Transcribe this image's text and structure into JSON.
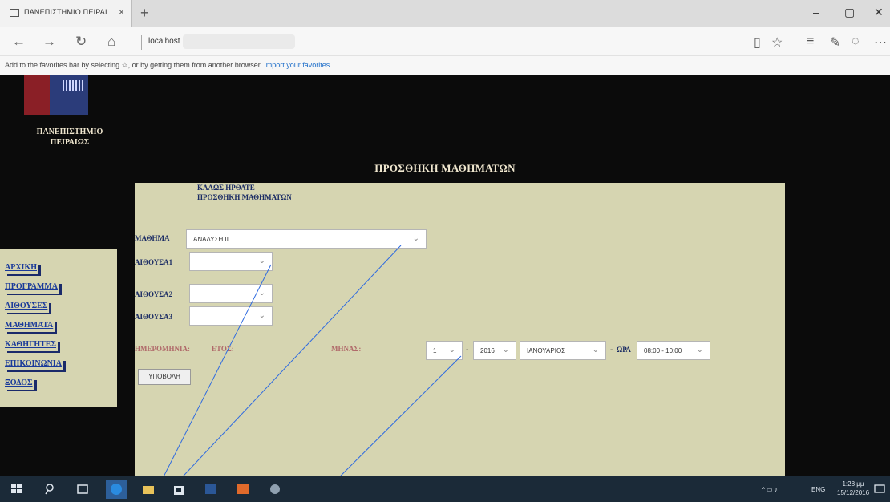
{
  "browser": {
    "tab_title": "ΠΑΝΕΠΙΣΤΗΜΙΟ ΠΕΙΡΑΙ",
    "tab_close": "×",
    "new_tab": "+",
    "url": "localhost",
    "favorites_text": "Add to the favorites bar by selecting ☆, or by getting them from another browser.",
    "favorites_link": "Import your favorites",
    "window_controls": {
      "minimize": "–",
      "maximize": "▢",
      "close": "✕"
    }
  },
  "page": {
    "university_name_line1": "ΠΑΝΕΠΙΣΤΗΜΙΟ",
    "university_name_line2": "ΠΕΙΡΑΙΩΣ",
    "title": "ΠΡΟΣΘΗΚΗ ΜΑΘΗΜΑΤΩΝ",
    "welcome_line1": "ΚΑΛΩΣ ΗΡΘΑΤΕ",
    "welcome_line2": "ΠΡΟΣΘΗΚΗ ΜΑΘΗΜΑΤΩΝ"
  },
  "sidebar": {
    "items": [
      {
        "label": "ΑΡΧΙΚΗ"
      },
      {
        "label": "ΠΡΟΓΡΑΜΜΑ"
      },
      {
        "label": "ΑΙΘΟΥΣΕΣ"
      },
      {
        "label": "ΜΑΘΗΜΑΤΑ"
      },
      {
        "label": "ΚΑΘΗΓΗΤΕΣ"
      },
      {
        "label": "ΕΠΙΚΟΙΝΩΝΙΑ"
      },
      {
        "label": "ΞΟΔΟΣ"
      }
    ]
  },
  "form": {
    "course_label": "ΜΑΘΗΜΑ",
    "course_value": "ΑΝΑΛΥΣΗ ΙΙ",
    "room1_label": "ΑΙΘΟΥΣΑ1",
    "room1_value": "",
    "room2_label": "ΑΙΘΟΥΣΑ2",
    "room2_value": "",
    "room3_label": "ΑΙΘΟΥΣΑ3",
    "room3_value": "",
    "date_label": "ΗΜΕΡΟΜΗΝΙΑ:",
    "year_label": "ΕΤΟΣ:",
    "month_label": "ΜΗΝΑΣ:",
    "day_value": "1",
    "year_value": "2016",
    "month_value": "ΙΑΝΟΥΑΡΙΟΣ",
    "dash": "-",
    "time_label": "ΩΡΑ",
    "time_value": "08:00 - 10:00",
    "submit_label": "ΥΠΟΒΟΛΗ"
  },
  "taskbar": {
    "tray_text": "ENG",
    "time": "1:28 μμ",
    "date": "15/12/2016"
  },
  "icons": {
    "back": "back-arrow-icon",
    "forward": "forward-arrow-icon",
    "refresh": "refresh-icon",
    "home": "home-icon",
    "favorites": "star-icon",
    "hub": "hub-icon",
    "notes": "notes-icon",
    "share": "share-icon",
    "more": "more-icon"
  },
  "colors": {
    "page_background": "#0b0b0b",
    "panel": "#d6d5b1",
    "title_text": "#f0e7cf",
    "form_label": "#1b2c64",
    "nav_link": "#1a3a9a",
    "date_labels": "#b06a6a",
    "annotation": "#2f6be0"
  }
}
